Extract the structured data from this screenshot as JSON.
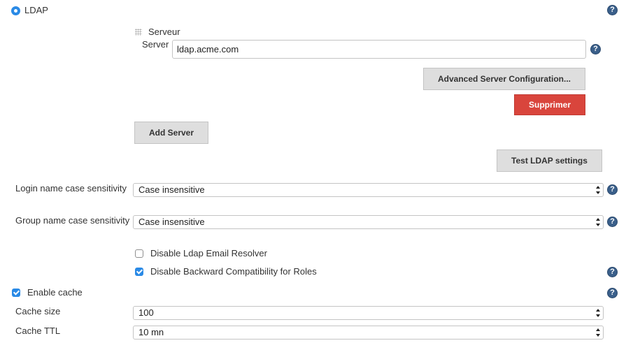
{
  "ldap": {
    "radio_label": "LDAP",
    "server_section": {
      "header": "Serveur",
      "server_label": "Server",
      "server_value": "ldap.acme.com",
      "advanced_button": "Advanced Server Configuration...",
      "delete_button": "Supprimer"
    },
    "add_server_button": "Add Server",
    "test_button": "Test LDAP settings",
    "login_case": {
      "label": "Login name case sensitivity",
      "value": "Case insensitive"
    },
    "group_case": {
      "label": "Group name case sensitivity",
      "value": "Case insensitive"
    },
    "disable_email_resolver": {
      "label": "Disable Ldap Email Resolver",
      "checked": false
    },
    "disable_backward_compat": {
      "label": "Disable Backward Compatibility for Roles",
      "checked": true
    },
    "enable_cache": {
      "label": "Enable cache",
      "checked": true
    },
    "cache_size": {
      "label": "Cache size",
      "value": "100"
    },
    "cache_ttl": {
      "label": "Cache TTL",
      "value": "10 mn"
    },
    "help_glyph": "?"
  },
  "colors": {
    "accent": "#2a8ae6",
    "danger": "#d9453c",
    "help": "#3a5f8a"
  }
}
